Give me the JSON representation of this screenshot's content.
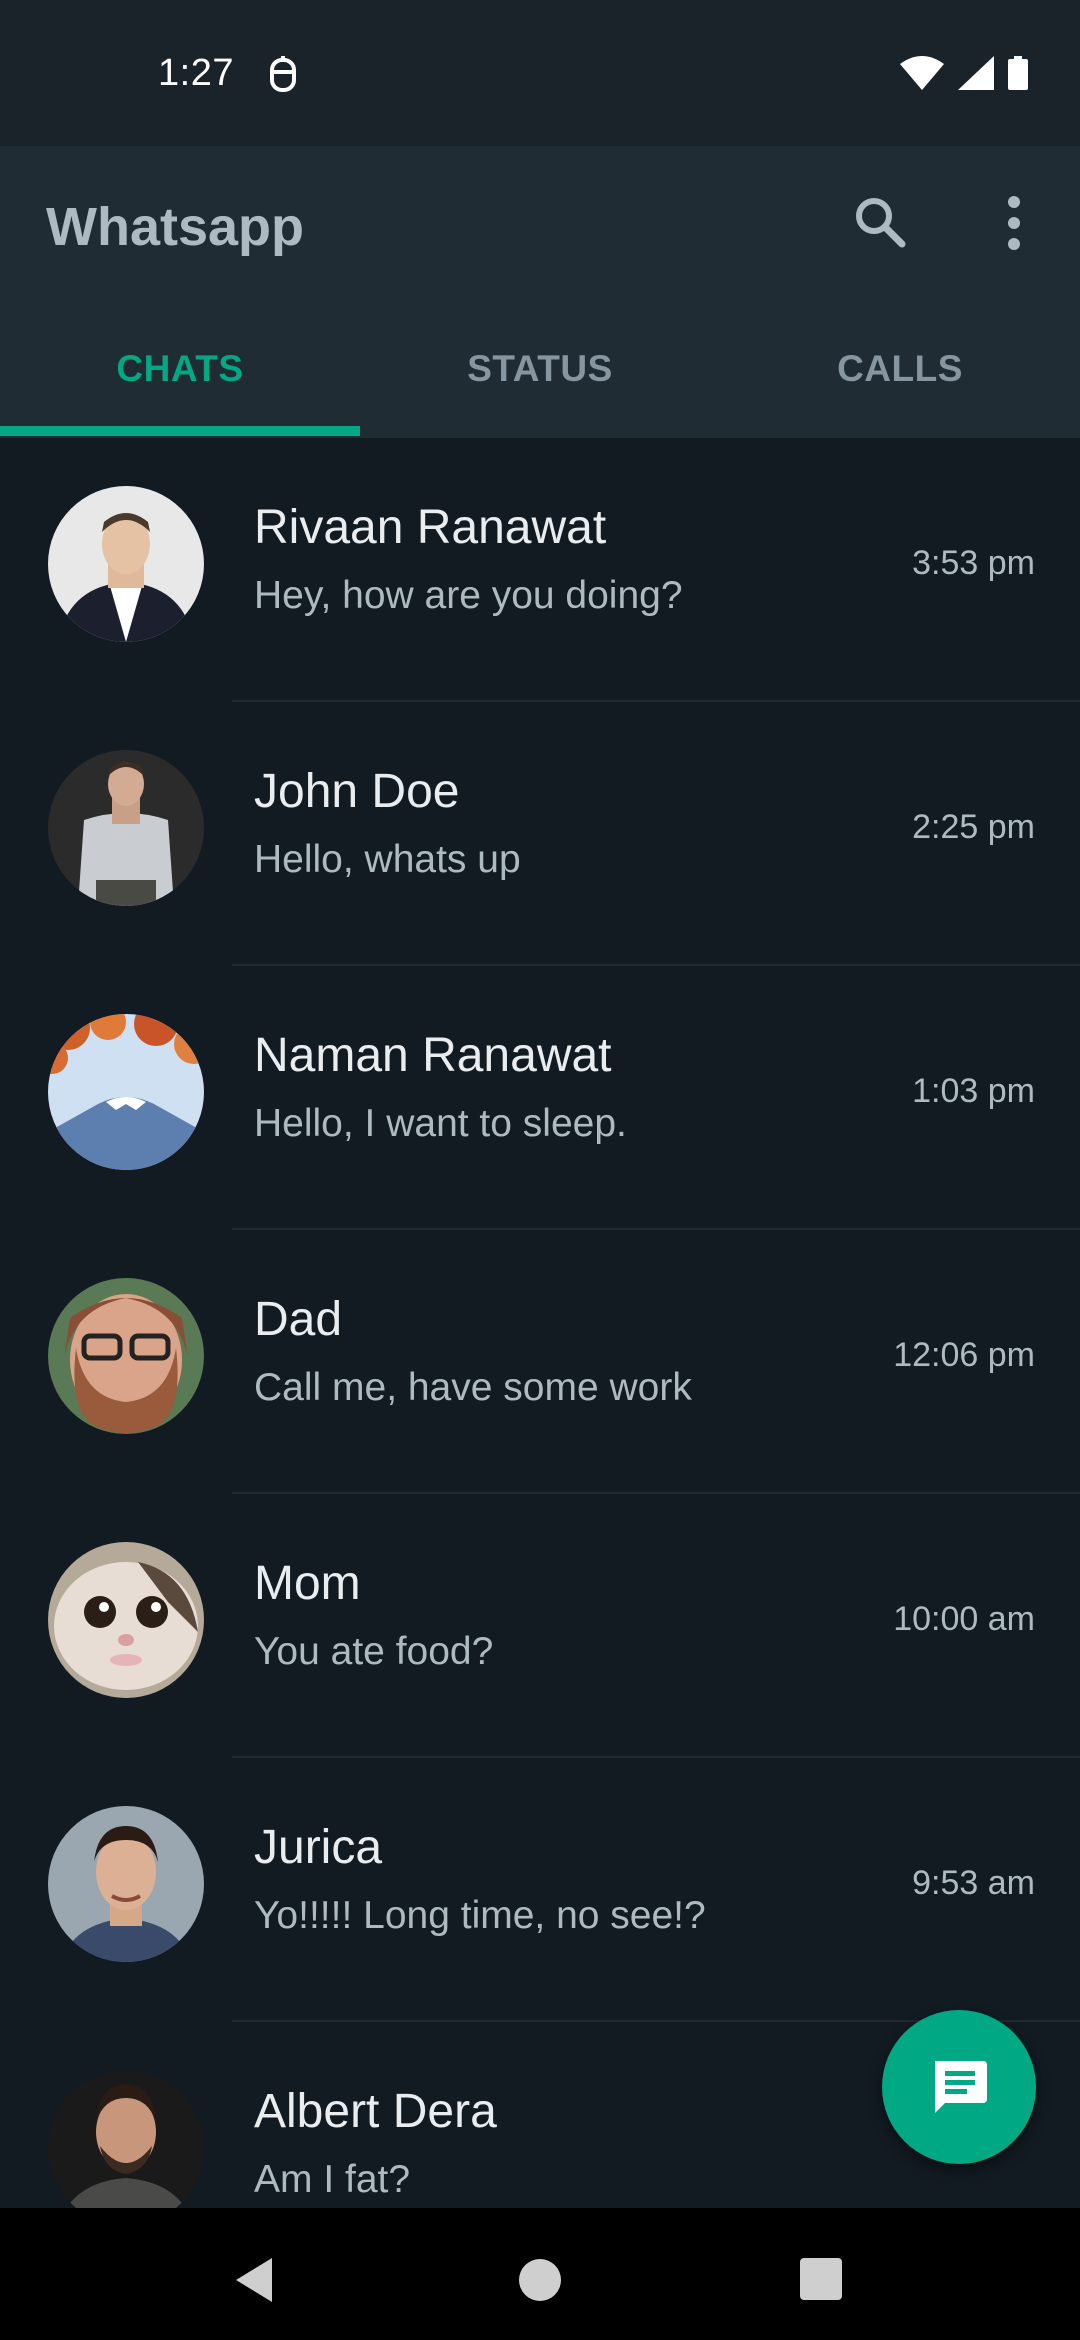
{
  "status_bar": {
    "time": "1:27",
    "icons": [
      "notification-icon",
      "wifi-icon",
      "signal-icon",
      "battery-icon"
    ]
  },
  "app_bar": {
    "title": "Whatsapp",
    "actions": [
      "search-icon",
      "more-vert-icon"
    ]
  },
  "tabs": [
    {
      "label": "CHATS",
      "active": true
    },
    {
      "label": "STATUS",
      "active": false
    },
    {
      "label": "CALLS",
      "active": false
    }
  ],
  "chats": [
    {
      "name": "Rivaan Ranawat",
      "message": "Hey, how are you doing?",
      "time": "3:53 pm",
      "avatar": "avatar-man-suit"
    },
    {
      "name": "John Doe",
      "message": "Hello, whats up",
      "time": "2:25 pm",
      "avatar": "avatar-man-tshirt"
    },
    {
      "name": "Naman Ranawat",
      "message": "Hello, I want to sleep.",
      "time": "1:03 pm",
      "avatar": "avatar-mountain"
    },
    {
      "name": "Dad",
      "message": "Call me, have some work",
      "time": "12:06 pm",
      "avatar": "avatar-man-glasses"
    },
    {
      "name": "Mom",
      "message": "You ate food?",
      "time": "10:00 am",
      "avatar": "avatar-cat"
    },
    {
      "name": "Jurica",
      "message": "Yo!!!!! Long time, no see!?",
      "time": "9:53 am",
      "avatar": "avatar-man-smiling"
    },
    {
      "name": "Albert Dera",
      "message": "Am I fat?",
      "time": "",
      "avatar": "avatar-man-beard"
    }
  ],
  "fab": {
    "icon": "chat-message-icon"
  },
  "nav_bar": {
    "icons": [
      "back-icon",
      "home-icon",
      "recents-icon"
    ]
  },
  "colors": {
    "accent": "#00a884",
    "background": "#121b22",
    "app_bar": "#1f2c34",
    "status_bar": "#1a2329",
    "primary_text": "#e9edef",
    "secondary_text": "#aebac1"
  }
}
